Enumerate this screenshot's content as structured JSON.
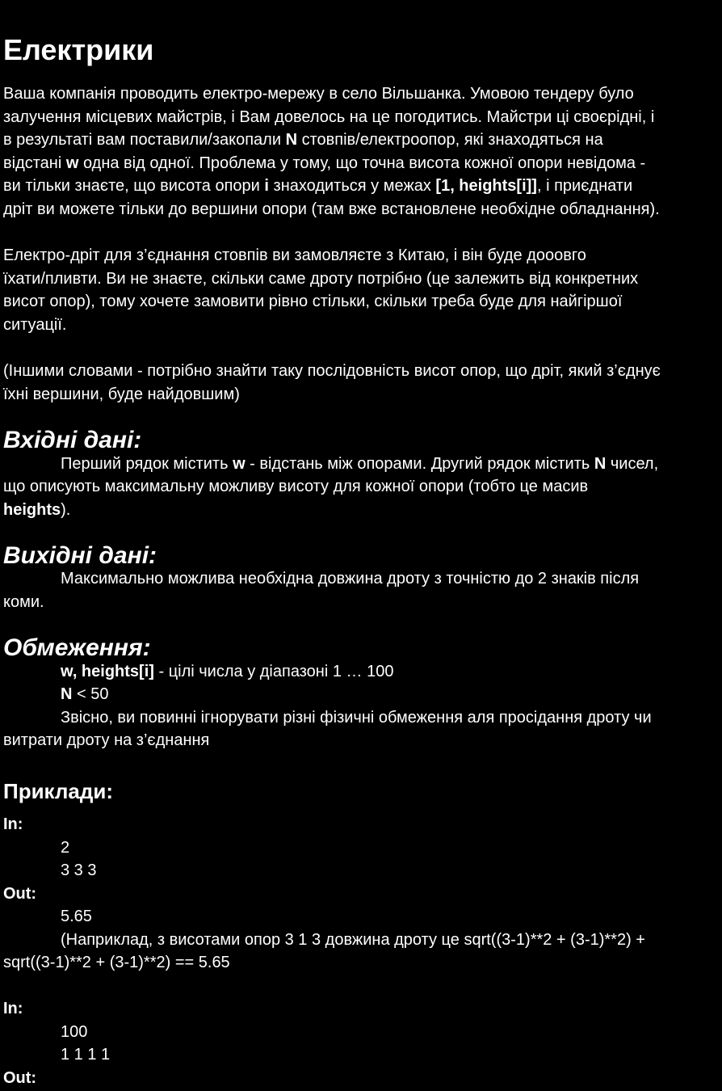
{
  "title": "Електрики",
  "intro": {
    "p1_l1": "Ваша компанія проводить електро-мережу в село Вільшанка.  Умовою тендеру було",
    "p1_l2": "залучення місцевих майстрів, і Вам довелось на це погодитись.  Майстри ці своєрідні, і",
    "p1_l3_a": "в результаті вам поставили/закопали ",
    "p1_l3_b": "N",
    "p1_l3_c": " стовпів/електроопор, які знаходяться на",
    "p1_l4_a": "відстані ",
    "p1_l4_b": "w",
    "p1_l4_c": " одна від одної.  Проблема у тому, що точна висота кожної опори невідома -",
    "p1_l5_a": "ви тільки знаєте, що висота опори ",
    "p1_l5_b": "i",
    "p1_l5_c": " знаходиться у межах ",
    "p1_l5_d": "[1, heights[i]]",
    "p1_l5_e": ", і приєднати",
    "p1_l6": "дріт ви можете тільки до вершини опори (там вже встановлене необхідне обладнання).",
    "p2_l1": "Електро-дріт для з’єднання стовпів ви замовляєте з Китаю, і він буде дооовго",
    "p2_l2": "їхати/пливти.    Ви не знаєте, скільки саме дроту потрібно (це залежить від конкретних",
    "p2_l3": "висот опор), тому хочете замовити рівно стільки, скільки треба буде для найгіршої",
    "p2_l4": "ситуації.",
    "p3_l1": "(Іншими словами - потрібно знайти таку послідовність висот опор, що дріт, який з’єднує",
    "p3_l2": "їхні вершини, буде найдовшим)"
  },
  "input_section": {
    "heading": "Вхідні дані:",
    "l1_a": "Перший рядок містить ",
    "l1_b": "w",
    "l1_c": " - відстань між опорами. Другий рядок містить ",
    "l1_d": "N",
    "l1_e": " чисел,",
    "l2": "що описують максимальну можливу висоту для кожної опори (тобто це масив",
    "l3_a": "heights",
    "l3_b": ")."
  },
  "output_section": {
    "heading": "Вихідні дані:",
    "l1": "Максимально можлива необхідна довжина дроту з точністю до 2 знаків після",
    "l2": "коми."
  },
  "constraints": {
    "heading": "Обмеження:",
    "c1_a": "w, heights[i]",
    "c1_b": " - цілі числа у діапазоні 1 … 100",
    "c2_a": "N",
    "c2_b": " < 50",
    "c3_l1": "Звісно, ви повинні ігнорувати різні фізичні обмеження аля просідання дроту чи",
    "c3_l2": "витрати дроту на з’єднання"
  },
  "examples": {
    "heading": "Приклади:",
    "ex1": {
      "in_label": "In:",
      "in_l1": "2",
      "in_l2": "3 3 3",
      "out_label": "Out:",
      "out_l1": "5.65",
      "note_l1": "(Наприклад, з висотами опор 3 1 3 довжина дроту це sqrt((3-1)**2 + (3-1)**2) +",
      "note_l2": "sqrt((3-1)**2 + (3-1)**2) == 5.65"
    },
    "ex2": {
      "in_label": "In:",
      "in_l1": "100",
      "in_l2": "1 1 1 1",
      "out_label": "Out:"
    }
  }
}
